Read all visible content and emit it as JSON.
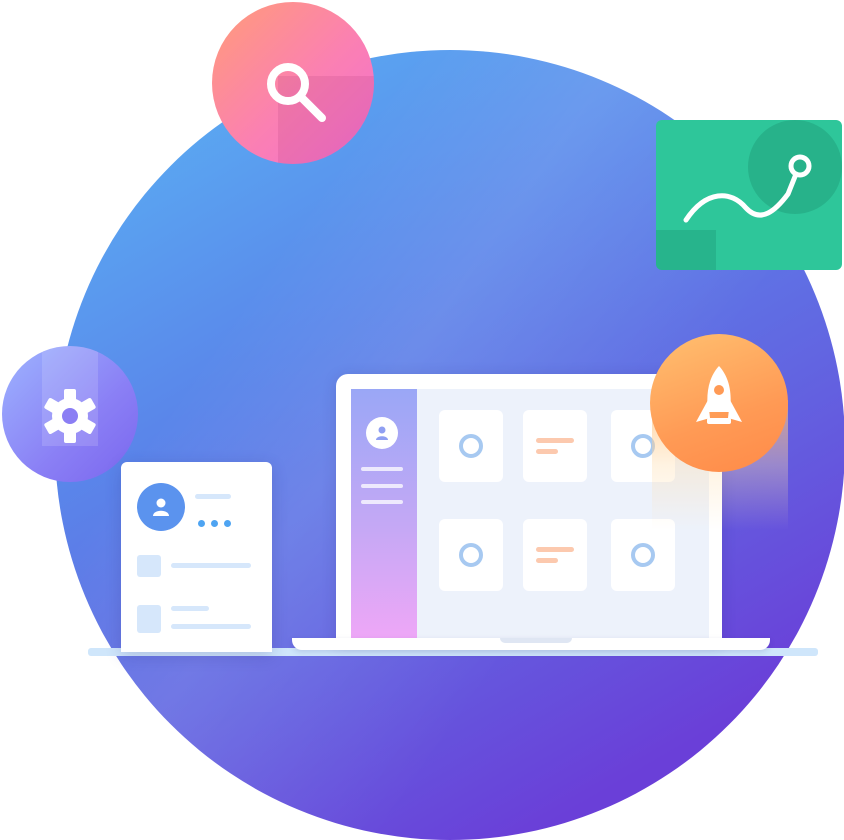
{
  "colors": {
    "background_circle": [
      "#5bb8f5",
      "#6a3fd8"
    ],
    "search_bubble": [
      "#ff9c78",
      "#f26fd2"
    ],
    "chart_card": "#2ec69a",
    "gear_bubble": [
      "#9db4ff",
      "#7a66ee"
    ],
    "rocket_bubble": [
      "#ffc070",
      "#ff8a48"
    ],
    "contact_avatar": "#5b93ee",
    "tile_ring": "#a7c9f1",
    "tile_bars": "#fcc9ae",
    "floor": "#cfe6fb"
  },
  "icons": {
    "search": "search-icon",
    "chart": "trend-line-icon",
    "settings": "gear-icon",
    "rocket": "rocket-icon",
    "user": "user-icon",
    "more": "more-dots-icon"
  },
  "laptop": {
    "sidebar_items": 3,
    "tiles": [
      "ring",
      "bars",
      "ring",
      "ring",
      "bars",
      "ring"
    ]
  },
  "contact_card": {
    "rows": 2
  }
}
